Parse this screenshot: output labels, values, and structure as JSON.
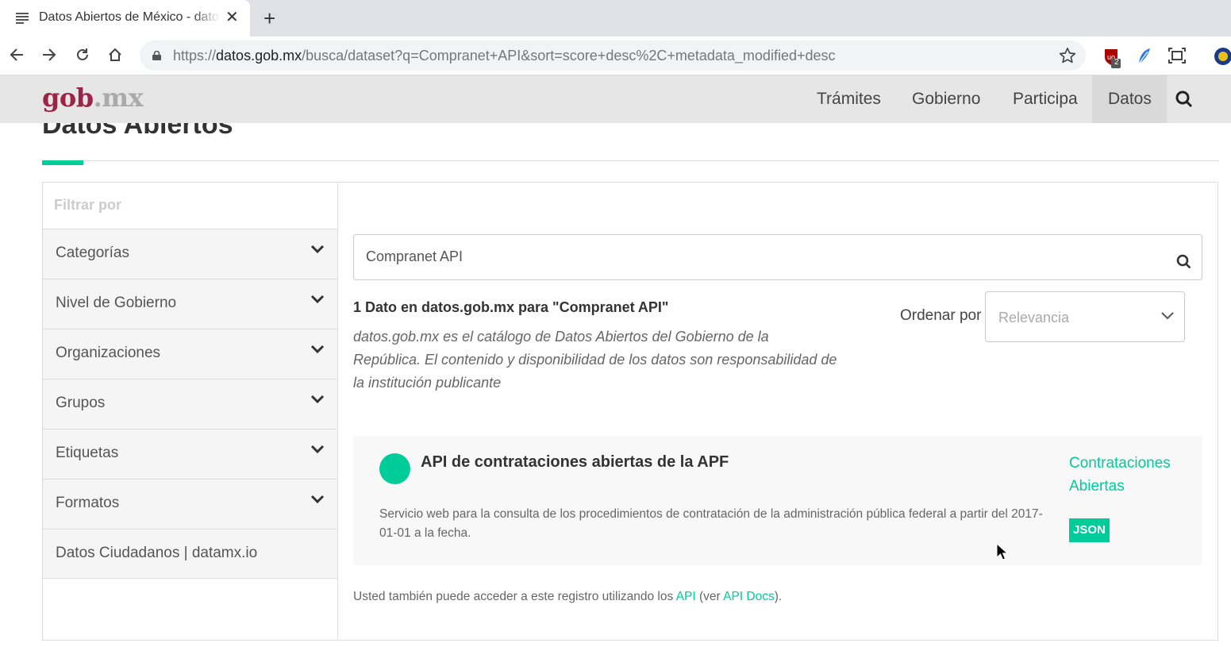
{
  "browser": {
    "tab_title": "Datos Abiertos de México - datos.gob.mx",
    "url_scheme": "https://",
    "url_host": "datos.gob.mx",
    "url_path": "/busca/dataset?q=Compranet+API&sort=score+desc%2C+metadata_modified+desc",
    "extension_badge": "2"
  },
  "site": {
    "logo_main": "gob",
    "logo_dot": ".",
    "logo_tld": "mx",
    "nav": [
      "Trámites",
      "Gobierno",
      "Participa",
      "Datos"
    ],
    "page_title": "Datos Abiertos"
  },
  "sidebar": {
    "header": "Filtrar por",
    "facets": [
      "Categorías",
      "Nivel de Gobierno",
      "Organizaciones",
      "Grupos",
      "Etiquetas",
      "Formatos"
    ],
    "link": "Datos Ciudadanos | datamx.io"
  },
  "search": {
    "value": "Compranet API",
    "result_count": "1 Dato en datos.gob.mx para \"Compranet API\"",
    "note": "datos.gob.mx es el catálogo de Datos Abiertos del Gobierno de la República. El contenido y disponibilidad de los datos son responsabilidad de la institución publicante",
    "sort_label": "Ordenar por",
    "sort_value": "Relevancia"
  },
  "result": {
    "title": "API de contrataciones abiertas de la APF",
    "description": "Servicio web para la consulta de los procedimientos de contratación de la administración pública federal a partir del 2017-01-01 a la fecha.",
    "organization": "Contrataciones Abiertas",
    "format": "JSON"
  },
  "api_note": {
    "prefix": "Usted también puede acceder a este registro utilizando los ",
    "api_link": "API",
    "middle": " (ver ",
    "docs_link": "API Docs",
    "suffix": ")."
  },
  "colors": {
    "accent": "#00cc99",
    "brand": "#9d2449"
  }
}
